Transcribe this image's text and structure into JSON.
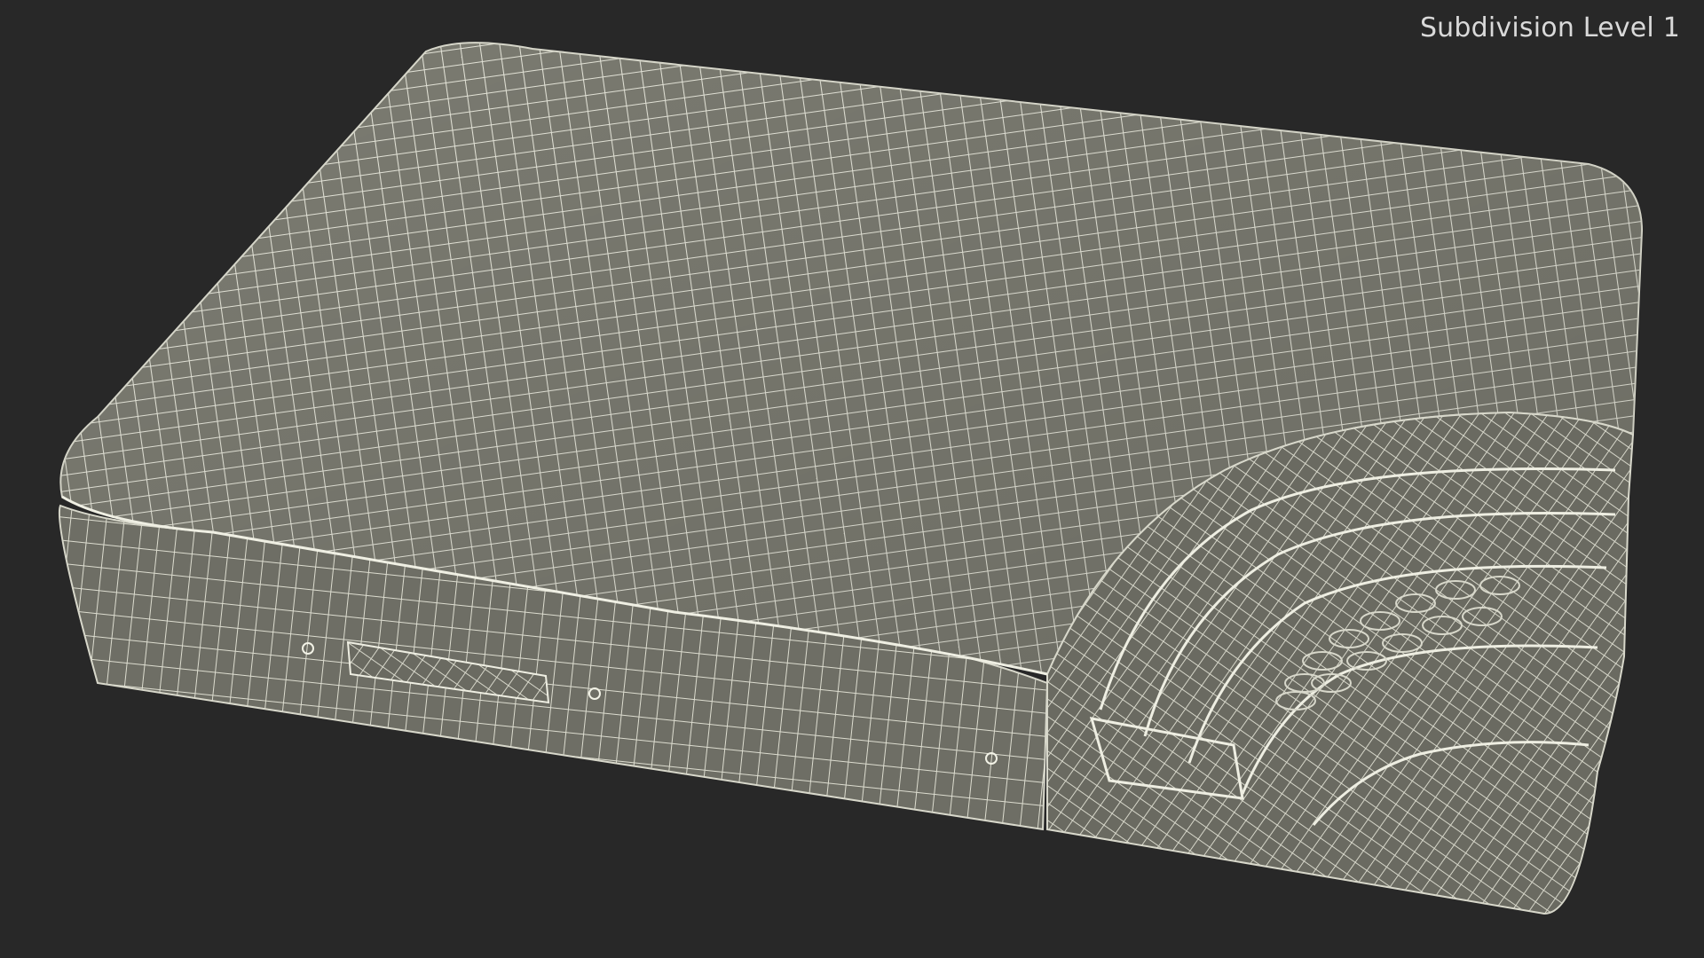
{
  "viewport": {
    "overlay_label": "Subdivision Level 1",
    "background_color": "#282828",
    "mesh_fill_color": "#7b7b71",
    "wire_color": "#e6e6da"
  },
  "model": {
    "name": "wireframe-mattress-cutaway"
  }
}
